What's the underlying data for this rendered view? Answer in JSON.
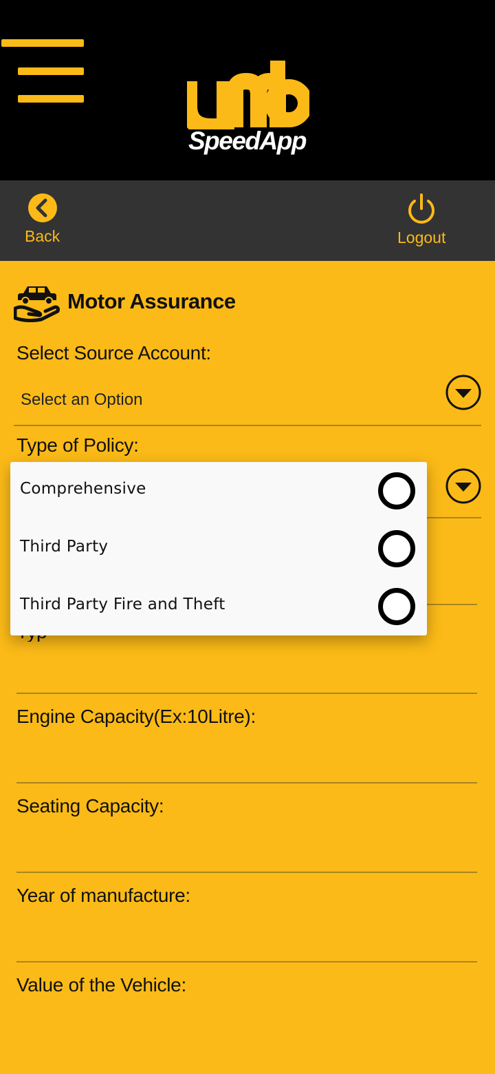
{
  "header": {
    "logo_mark": "umb",
    "logo_text": "SpeedApp",
    "menu_icon": "hamburger-menu-icon"
  },
  "nav": {
    "back_label": "Back",
    "logout_label": "Logout",
    "back_icon": "chevron-left-circle-icon",
    "logout_icon": "power-icon"
  },
  "page": {
    "title": "Motor Assurance",
    "title_icon": "car-in-hand-icon"
  },
  "form": {
    "source_account": {
      "label": "Select Source Account:",
      "value": "Select an Option"
    },
    "policy_type": {
      "label": "Type of Policy:"
    },
    "hidden_label_fragment": "Typ",
    "engine_capacity": {
      "label": "Engine Capacity(Ex:10Litre):",
      "value": ""
    },
    "seating_capacity": {
      "label": "Seating Capacity:",
      "value": ""
    },
    "year_of_manufacture": {
      "label": "Year of manufacture:",
      "value": ""
    },
    "vehicle_value": {
      "label": "Value of the Vehicle:",
      "value": ""
    }
  },
  "policy_options": [
    {
      "label": "Comprehensive",
      "selected": false
    },
    {
      "label": "Third Party",
      "selected": false
    },
    {
      "label": "Third Party Fire and Theft",
      "selected": false
    }
  ],
  "colors": {
    "brand_yellow": "#FBBA17",
    "header_black": "#000000",
    "navbar_gray": "#333333",
    "popup_bg": "#F9F9F9"
  }
}
